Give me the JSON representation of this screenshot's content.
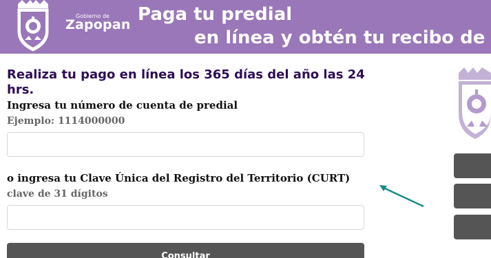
{
  "header": {
    "logo_small": "Gobierno de",
    "logo_big": "Zapopan",
    "headline_line1": "Paga tu predial",
    "headline_line2": "en línea y obtén tu recibo de pago"
  },
  "form": {
    "title": "Realiza tu pago en línea los 365 días del año las 24 hrs.",
    "account_label": "Ingresa tu número de cuenta de predial",
    "account_hint": "Ejemplo: 1114000000",
    "account_value": "",
    "curt_label": "o ingresa tu Clave Única del Registro del Territorio (CURT)",
    "curt_hint": "clave de 31 dígitos",
    "curt_value": "",
    "submit_label": "Consultar"
  },
  "colors": {
    "banner": "#9977b8",
    "title": "#2e0c55",
    "button": "#555555",
    "arrow": "#1a8a86"
  },
  "icons": [
    "zapopan-shield-icon",
    "arrow-icon"
  ]
}
